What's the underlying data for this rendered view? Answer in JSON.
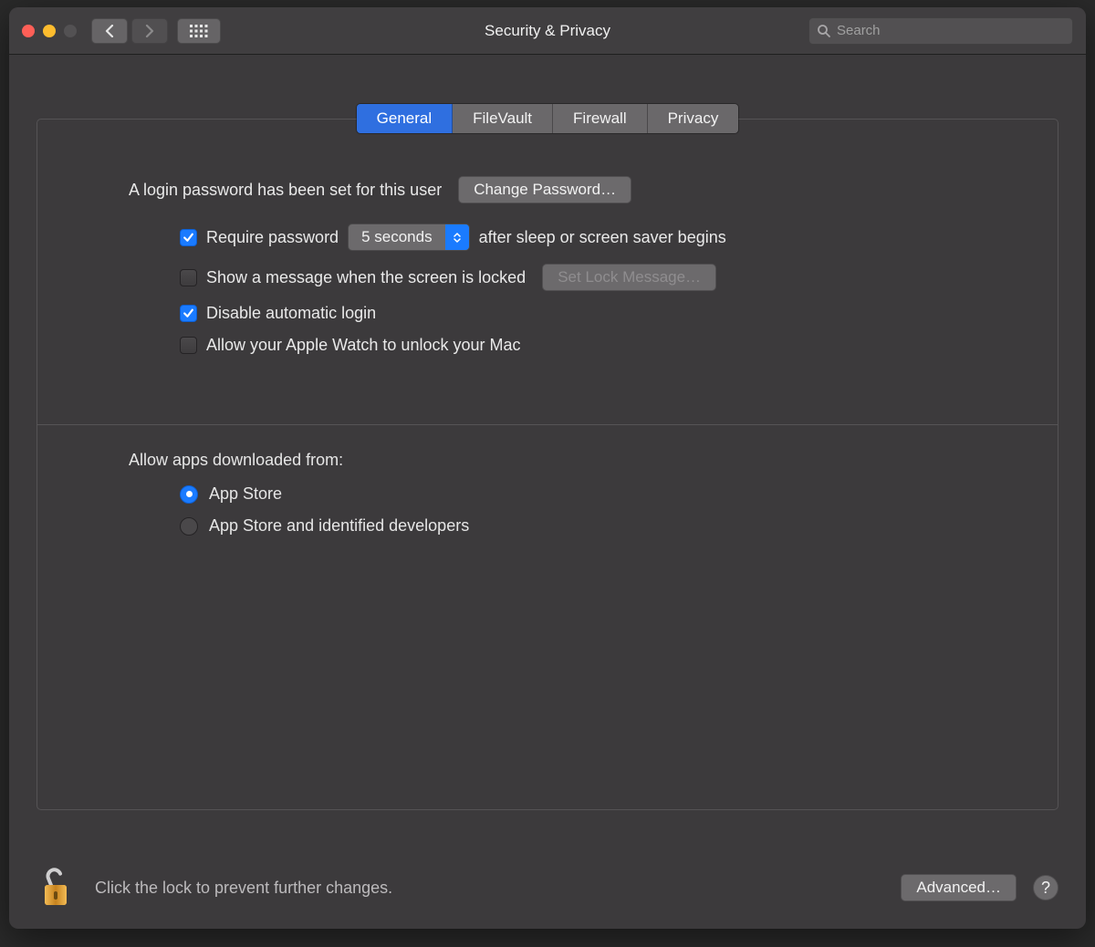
{
  "window": {
    "title": "Security & Privacy"
  },
  "search": {
    "placeholder": "Search"
  },
  "tabs": {
    "items": [
      {
        "label": "General"
      },
      {
        "label": "FileVault"
      },
      {
        "label": "Firewall"
      },
      {
        "label": "Privacy"
      }
    ]
  },
  "login": {
    "set_text": "A login password has been set for this user",
    "change_button": "Change Password…",
    "require_label": "Require password",
    "delay_value": "5 seconds",
    "after_text": "after sleep or screen saver begins",
    "show_message_label": "Show a message when the screen is locked",
    "set_lock_button": "Set Lock Message…",
    "disable_auto_label": "Disable automatic login",
    "watch_label": "Allow your Apple Watch to unlock your Mac"
  },
  "apps": {
    "title": "Allow apps downloaded from:",
    "option1": "App Store",
    "option2": "App Store and identified developers"
  },
  "footer": {
    "lock_text": "Click the lock to prevent further changes.",
    "advanced_button": "Advanced…"
  }
}
